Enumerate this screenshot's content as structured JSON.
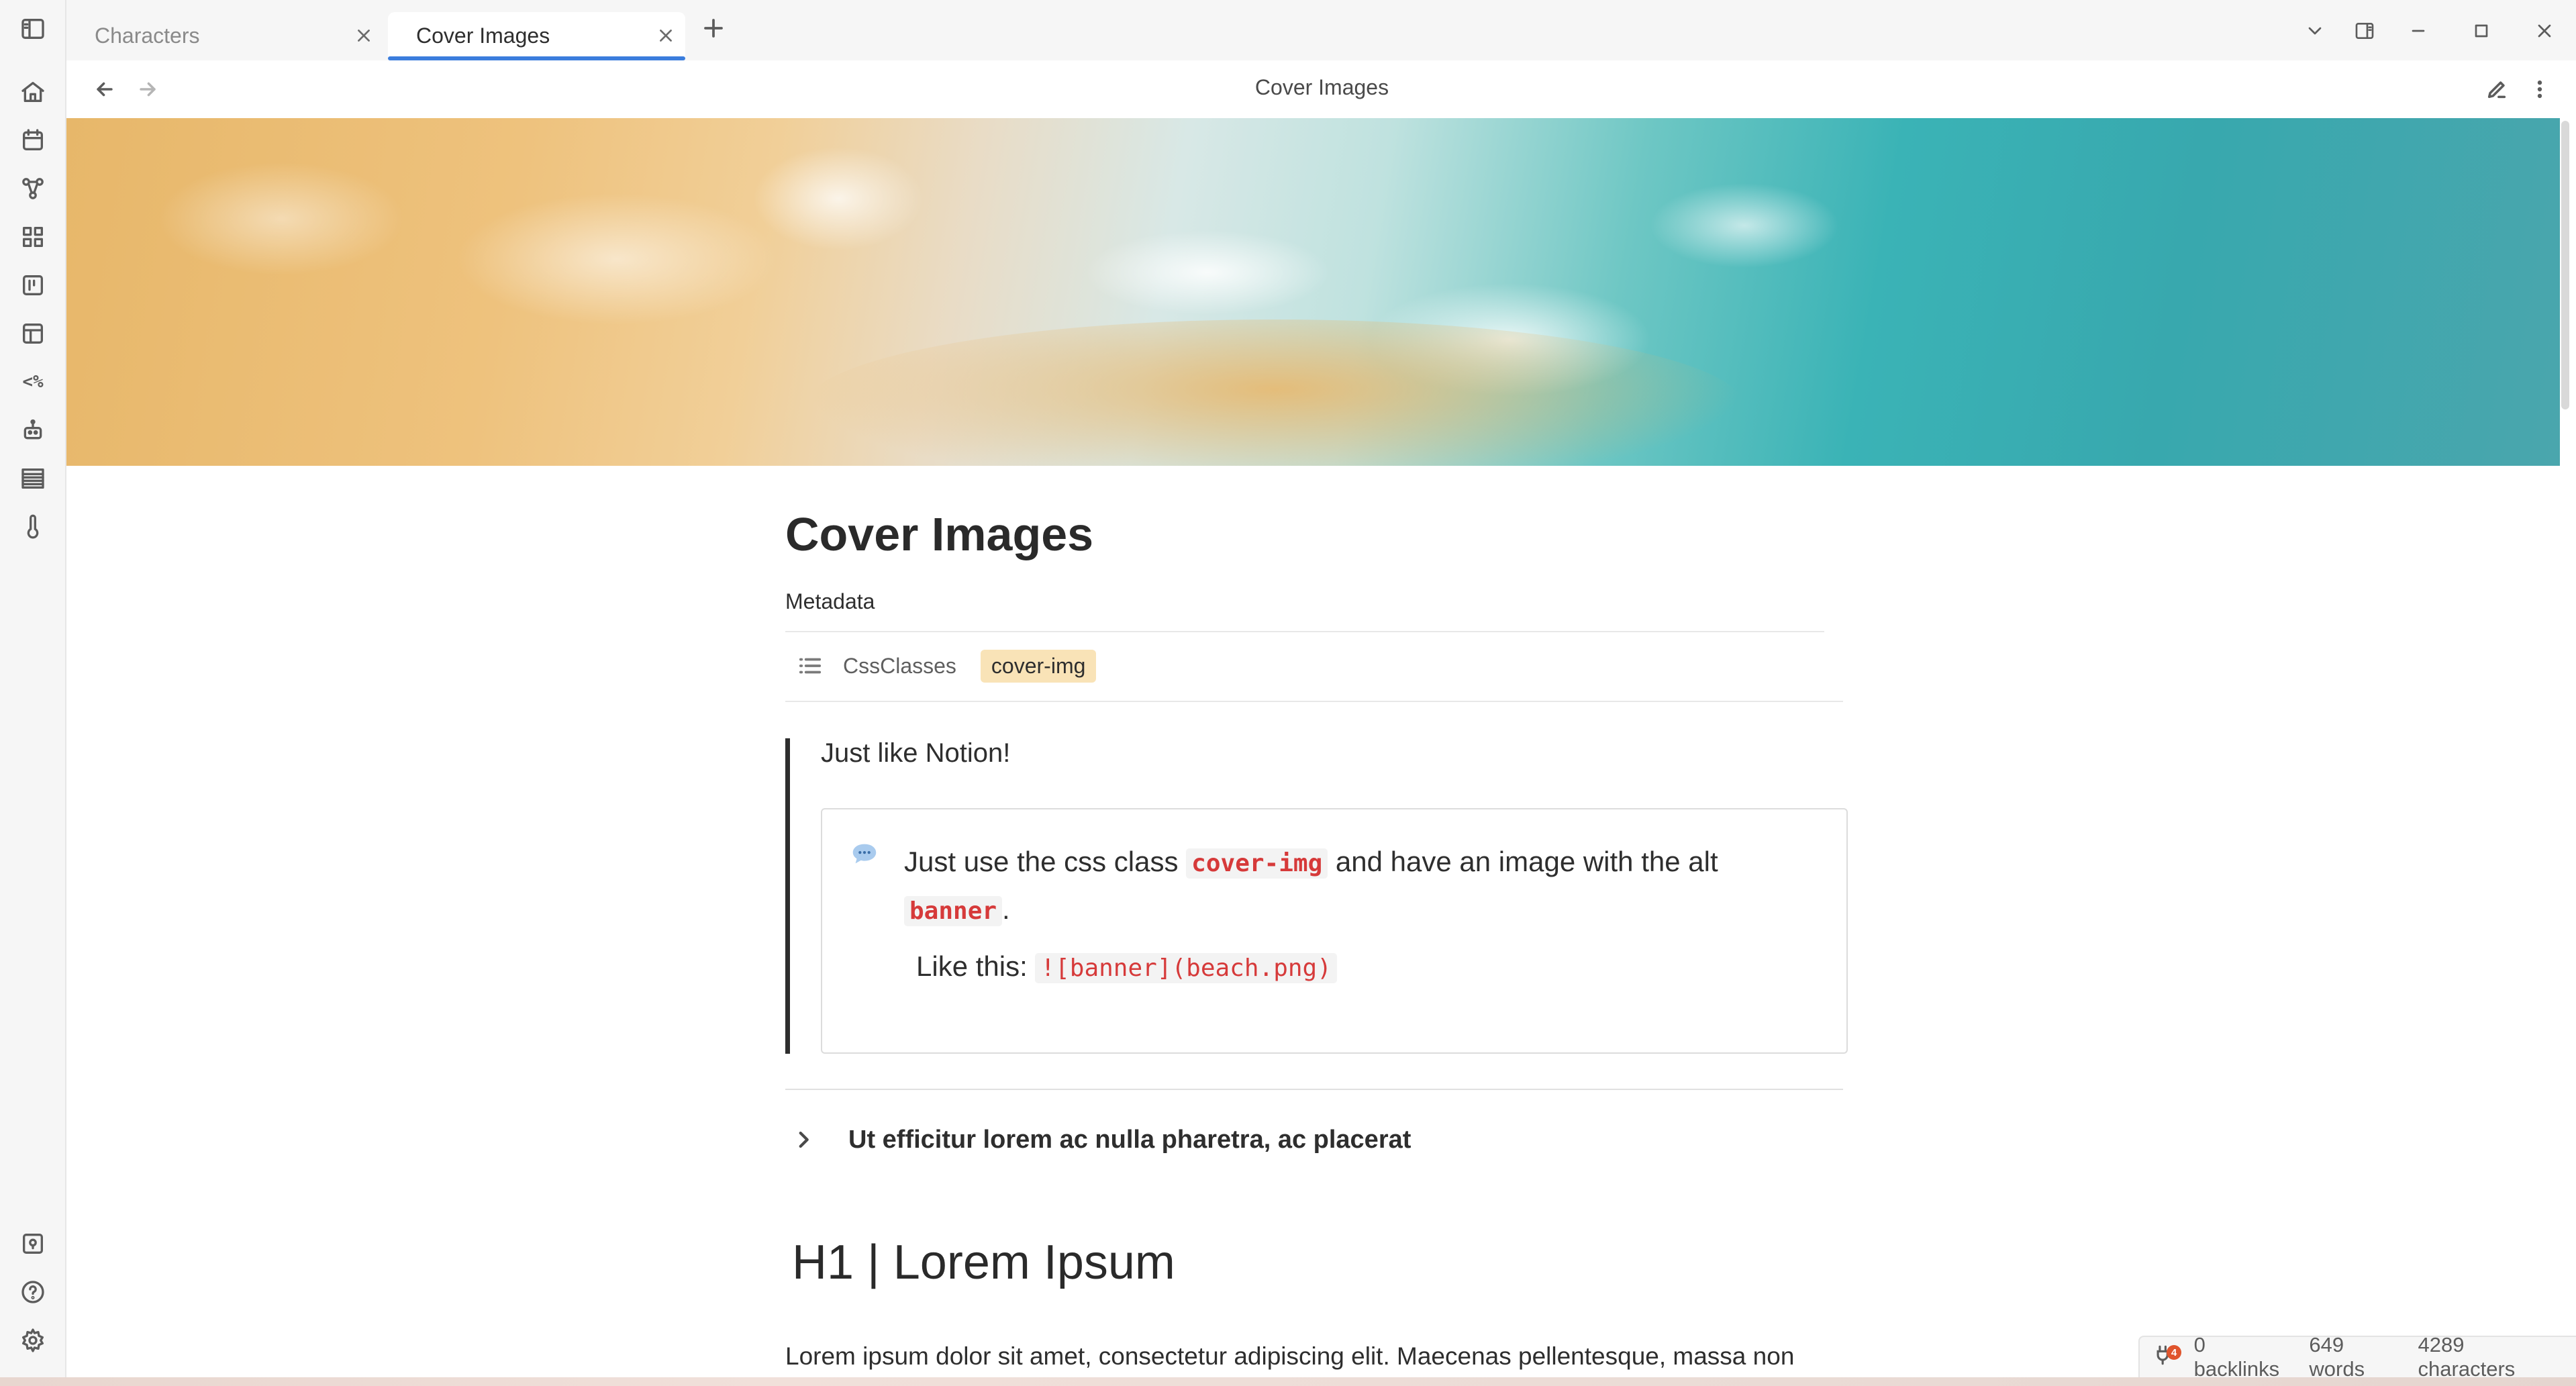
{
  "tabs": [
    {
      "label": "Characters",
      "active": false
    },
    {
      "label": "Cover Images",
      "active": true
    }
  ],
  "view": {
    "title": "Cover Images"
  },
  "ribbon": {
    "icons": [
      "home-icon",
      "calendar-icon",
      "graph-icon",
      "grid-icon",
      "kanban-icon",
      "layout-icon",
      "templater-icon",
      "robot-icon",
      "table-icon",
      "thermometer-icon"
    ],
    "templater_label": "<%",
    "bottom_icons": [
      "vault-icon",
      "help-icon",
      "settings-icon"
    ]
  },
  "document": {
    "title": "Cover Images",
    "metadata_label": "Metadata",
    "property": {
      "key": "CssClasses",
      "value": "cover-img"
    },
    "quote_text": "Just like Notion!",
    "callout": {
      "icon": "chat-bubble-icon",
      "text_before": "Just use the css class ",
      "code1": "cover-img",
      "text_middle": " and have an image with the alt ",
      "code2": "banner",
      "text_end": ".",
      "line2_prefix": "Like this: ",
      "line2_code": "![banner](beach.png)"
    },
    "fold_heading": "Ut efficitur lorem ac nulla pharetra, ac placerat",
    "h1": "H1 | Lorem Ipsum",
    "paragraph": "Lorem ipsum dolor sit amet, consectetur adipiscing elit. Maecenas pellentesque, massa non"
  },
  "status_bar": {
    "plugin_badge": "4",
    "backlinks": "0 backlinks",
    "words": "649 words",
    "characters": "4289 characters"
  },
  "colors": {
    "accent": "#3b7ddd",
    "code_red": "#d63a3a",
    "tag_bg": "#f9e3b7"
  }
}
